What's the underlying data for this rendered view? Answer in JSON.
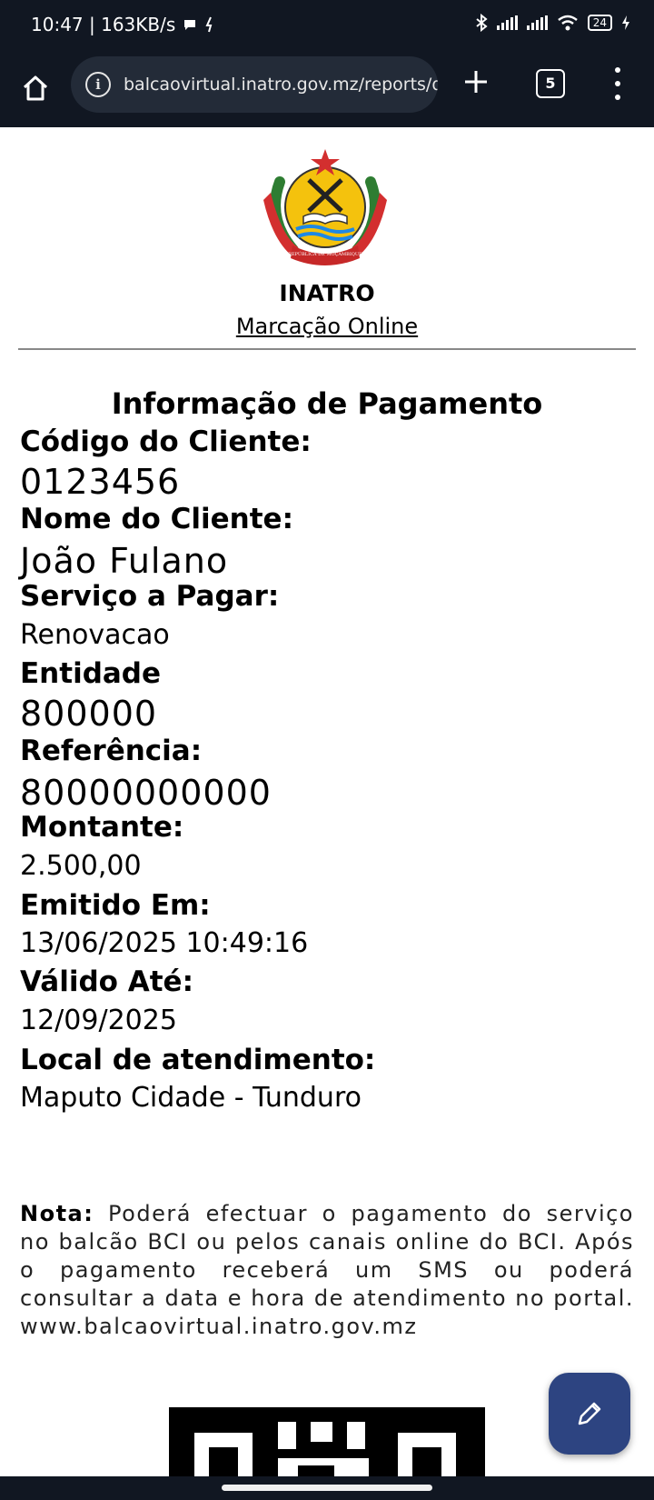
{
  "status_bar": {
    "time_speed": "10:47 | 163KB/s",
    "battery": "24"
  },
  "browser": {
    "url": "balcaovirtual.inatro.gov.mz/reports/dc",
    "tab_count": "5",
    "icons": [
      "home-icon",
      "info-icon",
      "plus-icon",
      "tabs-icon",
      "more-vert-icon"
    ]
  },
  "header": {
    "emblem_text": "REPÚBLICA DE MOÇAMBIQUE",
    "org_name": "INATRO",
    "subtitle": "Marcação Online"
  },
  "payment": {
    "title": "Informação de Pagamento",
    "fields": [
      {
        "label": "Código do Cliente:",
        "value": "0123456"
      },
      {
        "label": "Nome do Cliente:",
        "value": "João Fulano"
      },
      {
        "label": "Serviço a Pagar:",
        "value": "Renovacao"
      },
      {
        "label": "Entidade",
        "value": "800000"
      },
      {
        "label": "Referência:",
        "value": "80000000000"
      },
      {
        "label": "Montante:",
        "value": "2.500,00"
      },
      {
        "label": "Emitido Em:",
        "value": "13/06/2025 10:49:16"
      },
      {
        "label": "Válido Até:",
        "value": "12/09/2025"
      },
      {
        "label": "Local de atendimento:",
        "value": "Maputo Cidade - Tunduro"
      }
    ]
  },
  "note": {
    "label": "Nota:",
    "text": "Poderá efectuar o pagamento do serviço no balcão BCI ou pelos canais online do BCI. Após o pagamento receberá um SMS ou poderá consultar a data e hora de atendimento no portal. www.balcaovirtual.inatro.gov.mz"
  },
  "fab": {
    "icon": "pencil-icon"
  },
  "colors": {
    "system_bar": "#111722",
    "fab": "#2d4481"
  }
}
